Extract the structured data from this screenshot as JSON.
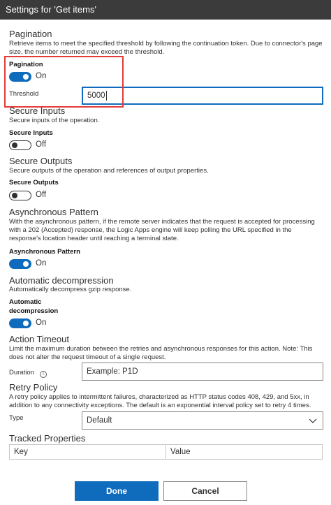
{
  "titlebar": {
    "title": "Settings for 'Get items'"
  },
  "pagination": {
    "heading": "Pagination",
    "description": "Retrieve items to meet the specified threshold by following the continuation token. Due to connector's page size, the number returned may exceed the threshold.",
    "toggle_label": "Pagination",
    "toggle_state": "On",
    "threshold_label": "Threshold",
    "threshold_value": "5000"
  },
  "secure_inputs": {
    "heading": "Secure Inputs",
    "description": "Secure inputs of the operation.",
    "toggle_label": "Secure Inputs",
    "toggle_state": "Off"
  },
  "secure_outputs": {
    "heading": "Secure Outputs",
    "description": "Secure outputs of the operation and references of output properties.",
    "toggle_label": "Secure Outputs",
    "toggle_state": "Off"
  },
  "async": {
    "heading": "Asynchronous Pattern",
    "description": "With the asynchronous pattern, if the remote server indicates that the request is accepted for processing with a 202 (Accepted) response, the Logic Apps engine will keep polling the URL specified in the response's location header until reaching a terminal state.",
    "toggle_label": "Asynchronous Pattern",
    "toggle_state": "On"
  },
  "decompression": {
    "heading": "Automatic decompression",
    "description": "Automatically decompress gzip response.",
    "toggle_label_line1": "Automatic",
    "toggle_label_line2": "decompression",
    "toggle_state": "On"
  },
  "timeout": {
    "heading": "Action Timeout",
    "description": "Limit the maximum duration between the retries and asynchronous responses for this action. Note: This does not alter the request timeout of a single request.",
    "duration_label": "Duration",
    "duration_placeholder": "Example: P1D",
    "info_glyph": "i"
  },
  "retry": {
    "heading": "Retry Policy",
    "description": "A retry policy applies to intermittent failures, characterized as HTTP status codes 408, 429, and 5xx, in addition to any connectivity exceptions. The default is an exponential interval policy set to retry 4 times.",
    "type_label": "Type",
    "type_value": "Default"
  },
  "tracked": {
    "heading": "Tracked Properties",
    "key_placeholder": "Key",
    "value_placeholder": "Value"
  },
  "buttons": {
    "done": "Done",
    "cancel": "Cancel"
  },
  "colors": {
    "accent": "#0f6cbd",
    "highlight": "#e23b3b",
    "titlebar": "#3b3b3b"
  },
  "icons": {
    "info": "info-icon",
    "chevron": "chevron-down-icon"
  }
}
